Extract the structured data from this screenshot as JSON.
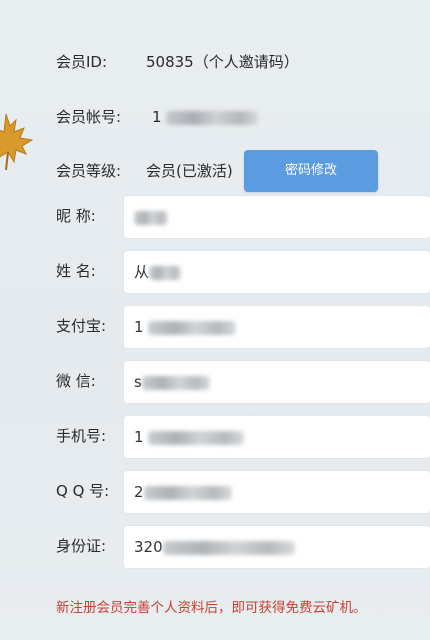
{
  "labels": {
    "member_id": "会员ID:",
    "account": "会员帐号:",
    "level": "会员等级:",
    "nickname": "昵  称:",
    "name": "姓  名:",
    "alipay": "支付宝:",
    "wechat": "微  信:",
    "phone": "手机号:",
    "qq": "Q Q 号:",
    "id_card": "身份证:"
  },
  "values": {
    "member_id": "50835（个人邀请码）",
    "account_prefix": "1",
    "level": "会员(已激活)",
    "name_prefix": "从",
    "alipay_prefix": "1",
    "wechat_prefix": "s",
    "phone_prefix": "1",
    "qq_prefix": "2",
    "id_card_prefix": "320"
  },
  "buttons": {
    "change_password": "密码修改"
  },
  "notice": "新注册会员完善个人资料后，即可获得免费云矿机。",
  "colors": {
    "button": "#5b9be0",
    "notice": "#c8402f",
    "background": "#e7ecef"
  },
  "icons": {
    "decoration": "maple-leaf-icon"
  }
}
